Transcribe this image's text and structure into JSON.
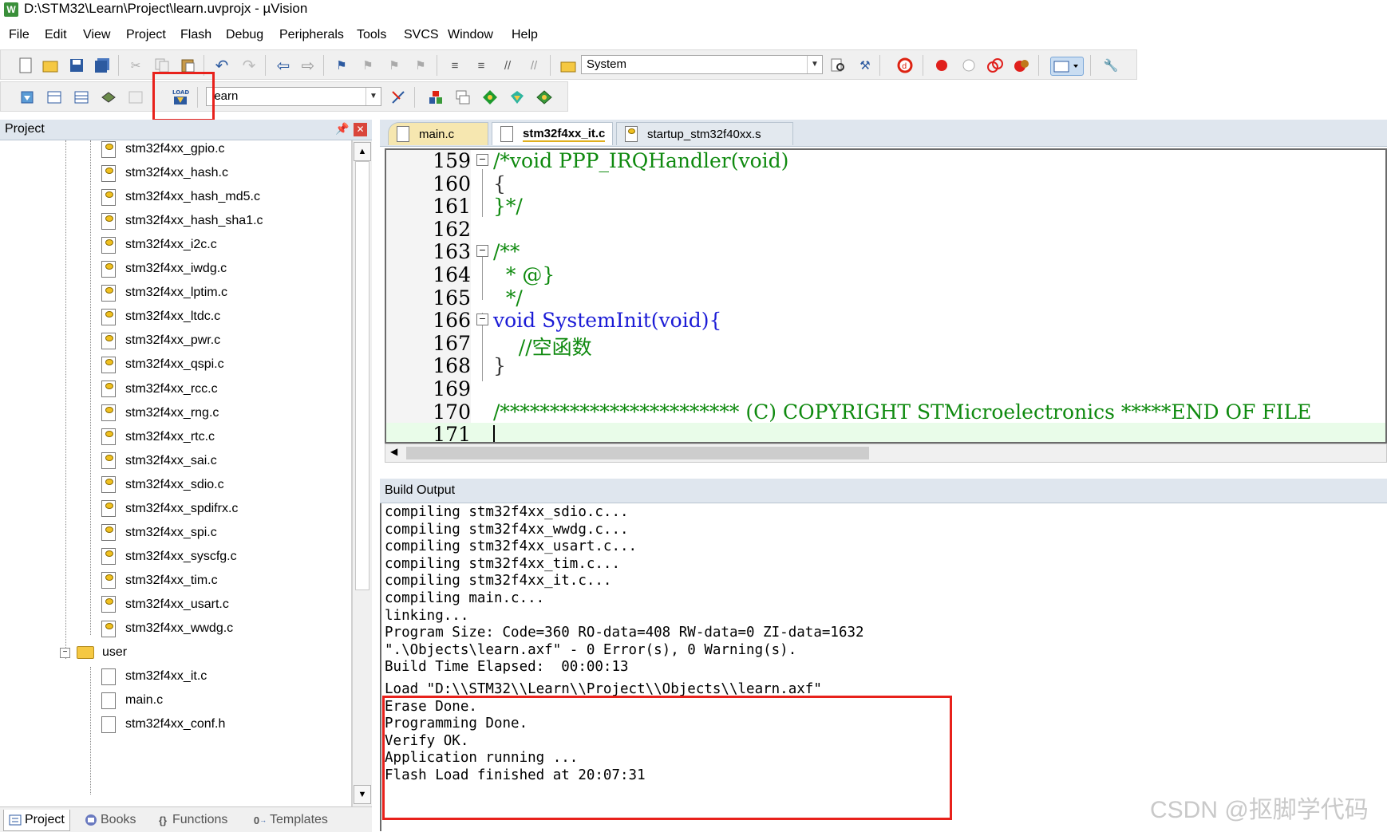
{
  "window": {
    "title": "D:\\STM32\\Learn\\Project\\learn.uvprojx - µVision",
    "app_icon": "W"
  },
  "menu": [
    {
      "label": "File"
    },
    {
      "label": "Edit"
    },
    {
      "label": "View"
    },
    {
      "label": "Project"
    },
    {
      "label": "Flash"
    },
    {
      "label": "Debug"
    },
    {
      "label": "Peripherals"
    },
    {
      "label": "Tools"
    },
    {
      "label": "SVCS"
    },
    {
      "label": "Window"
    },
    {
      "label": "Help"
    }
  ],
  "toolbar": {
    "find_combo_value": "System",
    "target_combo_value": "learn",
    "load_button_label": "LOAD"
  },
  "project_panel": {
    "title": "Project",
    "files": [
      "stm32f4xx_gpio.c",
      "stm32f4xx_hash.c",
      "stm32f4xx_hash_md5.c",
      "stm32f4xx_hash_sha1.c",
      "stm32f4xx_i2c.c",
      "stm32f4xx_iwdg.c",
      "stm32f4xx_lptim.c",
      "stm32f4xx_ltdc.c",
      "stm32f4xx_pwr.c",
      "stm32f4xx_qspi.c",
      "stm32f4xx_rcc.c",
      "stm32f4xx_rng.c",
      "stm32f4xx_rtc.c",
      "stm32f4xx_sai.c",
      "stm32f4xx_sdio.c",
      "stm32f4xx_spdifrx.c",
      "stm32f4xx_spi.c",
      "stm32f4xx_syscfg.c",
      "stm32f4xx_tim.c",
      "stm32f4xx_usart.c",
      "stm32f4xx_wwdg.c"
    ],
    "user_group": {
      "label": "user",
      "files": [
        "stm32f4xx_it.c",
        "main.c",
        "stm32f4xx_conf.h"
      ]
    },
    "bottom_tabs": [
      {
        "label": "Project",
        "icon": "project-icon"
      },
      {
        "label": "Books",
        "icon": "books-icon"
      },
      {
        "label": "Functions",
        "icon": "functions-icon"
      },
      {
        "label": "Templates",
        "icon": "templates-icon"
      }
    ]
  },
  "editor": {
    "tabs": [
      {
        "label": "main.c"
      },
      {
        "label": "stm32f4xx_it.c"
      },
      {
        "label": "startup_stm32f40xx.s"
      }
    ],
    "active_tab": "stm32f4xx_it.c",
    "lines": [
      {
        "num": "159",
        "text": "/*void PPP_IRQHandler(void)"
      },
      {
        "num": "160",
        "text": "{"
      },
      {
        "num": "161",
        "text": "}*/"
      },
      {
        "num": "162",
        "text": ""
      },
      {
        "num": "163",
        "text": "/**"
      },
      {
        "num": "164",
        "text": "  * @}"
      },
      {
        "num": "165",
        "text": "  */"
      },
      {
        "num": "166",
        "text": "void SystemInit(void){"
      },
      {
        "num": "167",
        "text": "    //空函数"
      },
      {
        "num": "168",
        "text": "}"
      },
      {
        "num": "169",
        "text": ""
      },
      {
        "num": "170",
        "text": "/************************ (C) COPYRIGHT STMicroelectronics *****END OF FILE"
      },
      {
        "num": "171",
        "text": ""
      }
    ]
  },
  "build_output": {
    "title": "Build Output",
    "lines": [
      "compiling stm32f4xx_sdio.c...",
      "compiling stm32f4xx_wwdg.c...",
      "compiling stm32f4xx_usart.c...",
      "compiling stm32f4xx_tim.c...",
      "compiling stm32f4xx_it.c...",
      "compiling main.c...",
      "linking...",
      "Program Size: Code=360 RO-data=408 RW-data=0 ZI-data=1632",
      "\".\\Objects\\learn.axf\" - 0 Error(s), 0 Warning(s).",
      "Build Time Elapsed:  00:00:13",
      "Load \"D:\\\\STM32\\\\Learn\\\\Project\\\\Objects\\\\learn.axf\"",
      "Erase Done.",
      "Programming Done.",
      "Verify OK.",
      "Application running ...",
      "Flash Load finished at 20:07:31"
    ]
  },
  "watermark": "CSDN @抠脚学代码",
  "colors": {
    "highlight_red": "#e8211b",
    "comment_green": "#0f8a0f",
    "keyword_blue": "#1b1bd6",
    "panel_header": "#dfe6ee"
  }
}
